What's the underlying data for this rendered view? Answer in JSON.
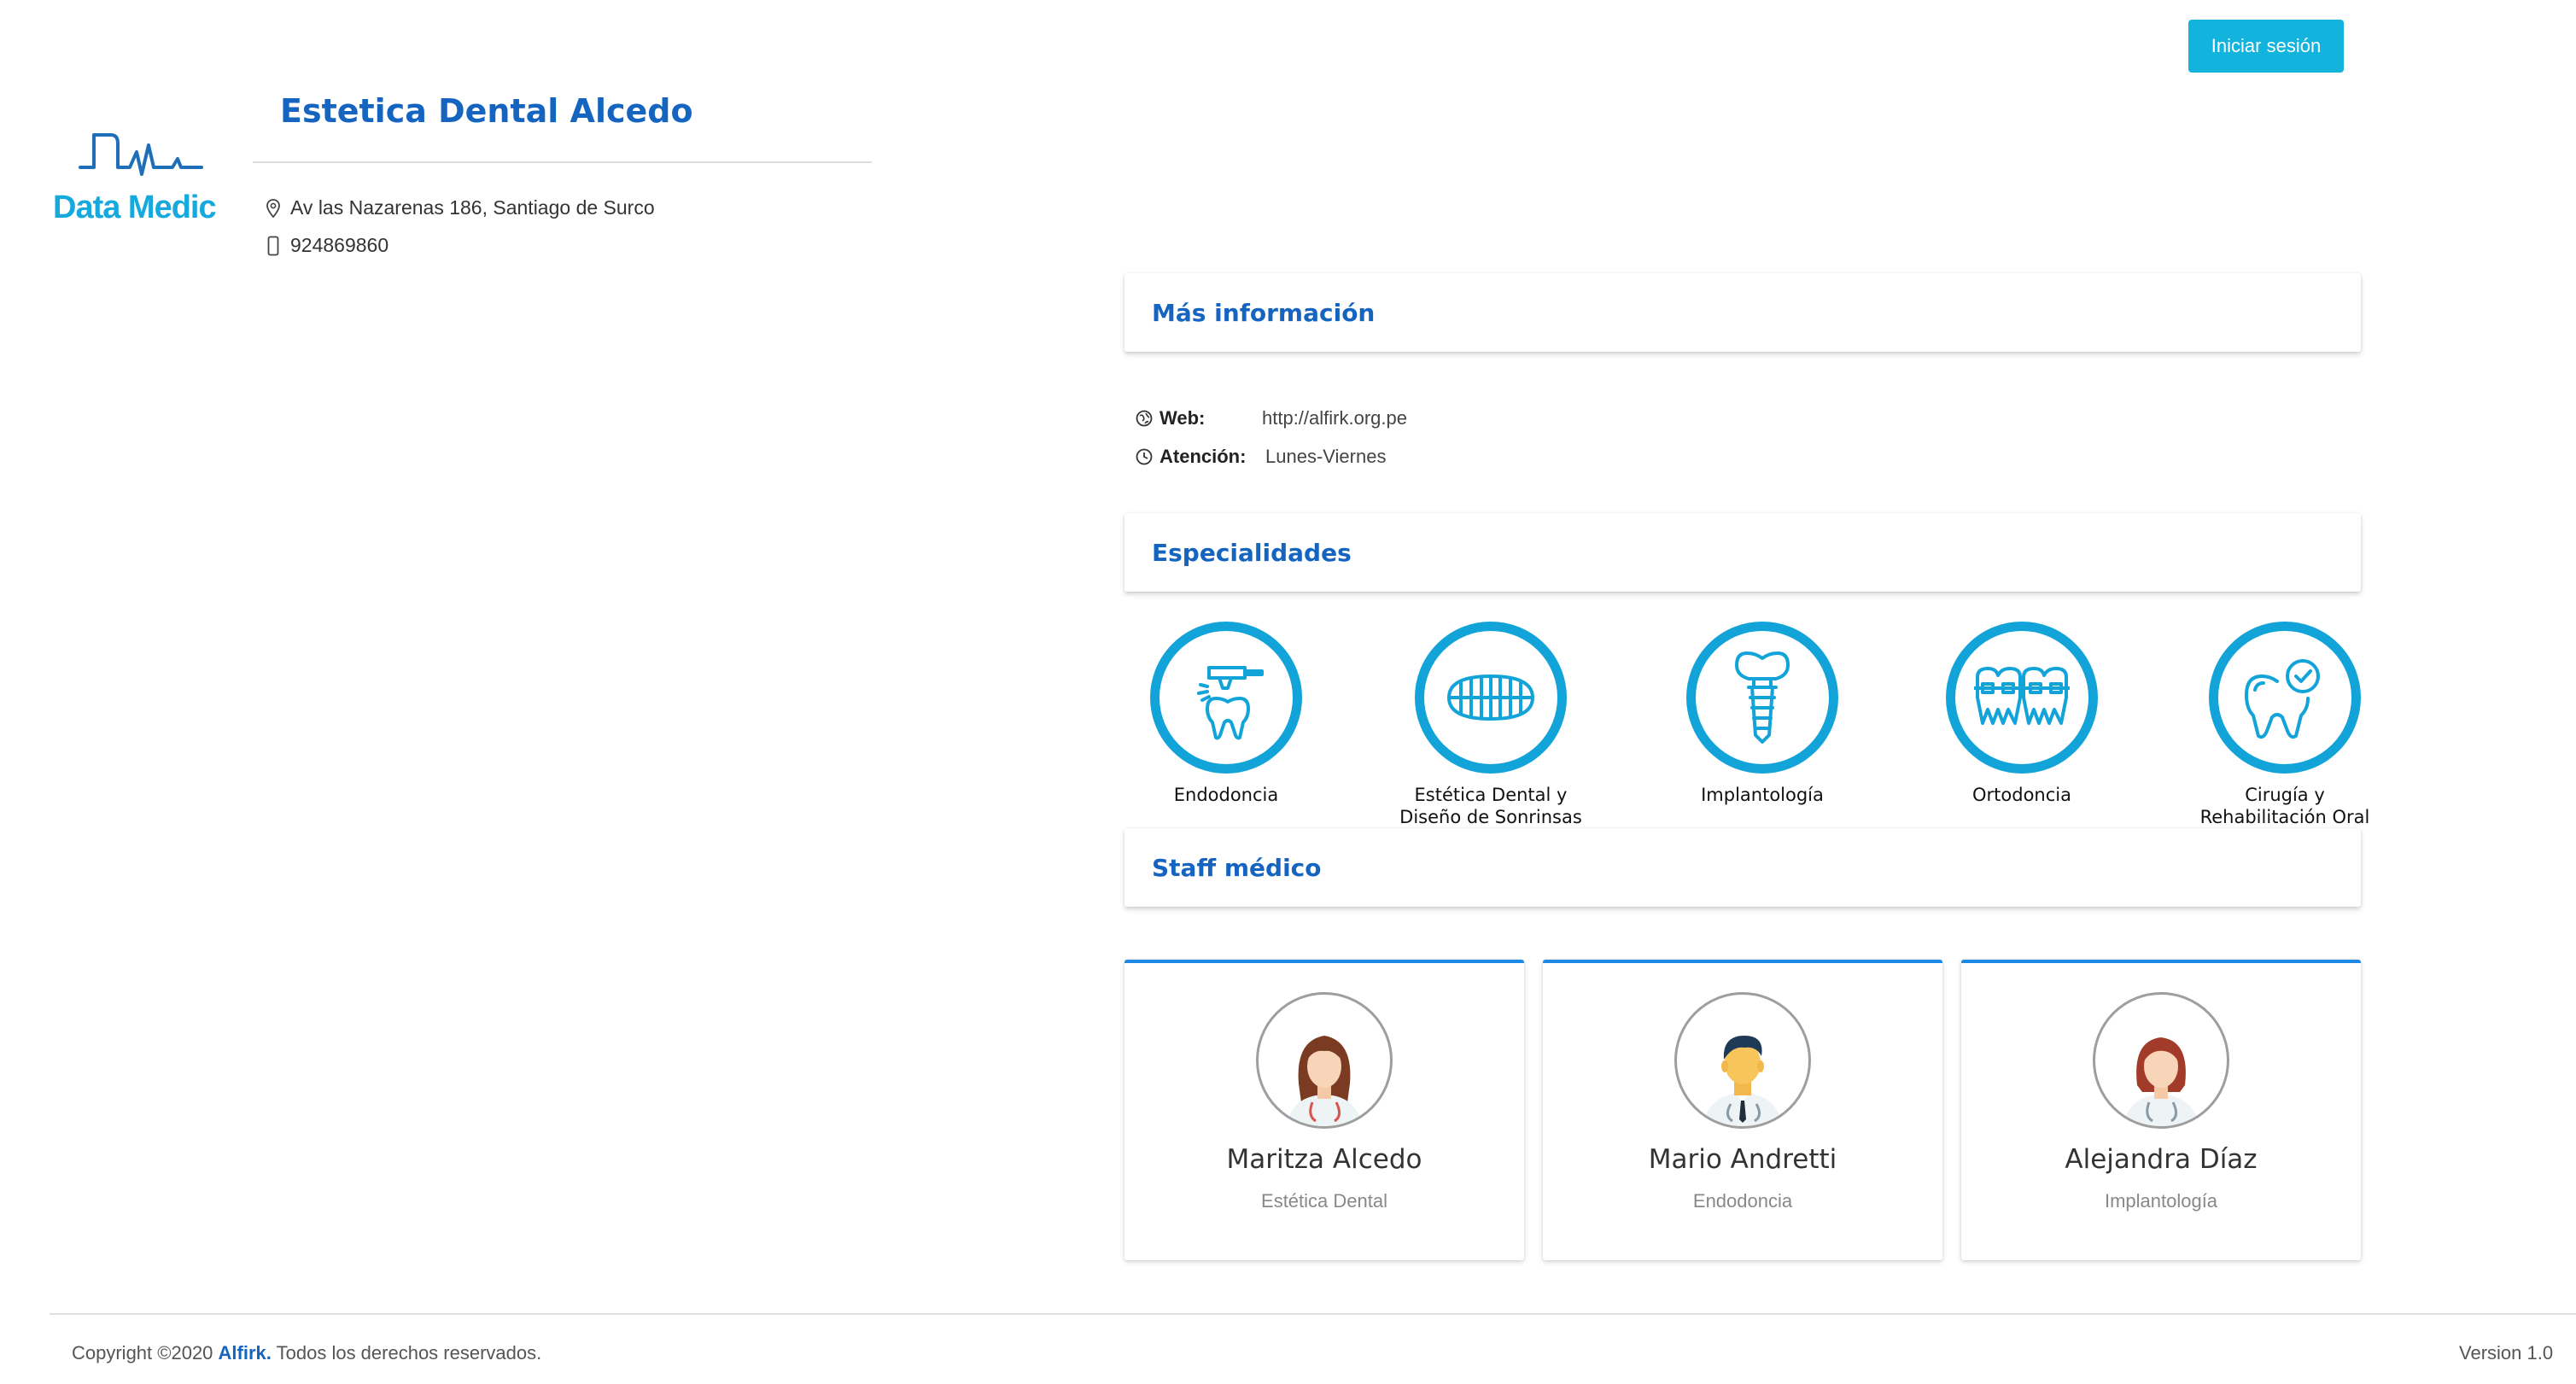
{
  "header": {
    "login_label": "Iniciar sesión",
    "logo_text": "Data Medic",
    "clinic_name": "Estetica Dental Alcedo",
    "address": "Av las Nazarenas 186, Santiago de Surco",
    "phone": "924869860"
  },
  "sections": {
    "info_title": "Más información",
    "specialties_title": "Especialidades",
    "staff_title": "Staff médico"
  },
  "info": {
    "web_label": "Web:",
    "web_value": "http://alfirk.org.pe",
    "attention_label": "Atención:",
    "attention_value": "Lunes-Viernes"
  },
  "specialties": [
    {
      "line1": "Endodoncia",
      "line2": "",
      "icon": "tooth-drill-icon"
    },
    {
      "line1": "Estética Dental y",
      "line2": "Diseño de Sonrinsas",
      "icon": "teeth-smile-icon"
    },
    {
      "line1": "Implantología",
      "line2": "",
      "icon": "dental-implant-icon"
    },
    {
      "line1": "Ortodoncia",
      "line2": "",
      "icon": "braces-icon"
    },
    {
      "line1": "Cirugía y",
      "line2": "Rehabilitación Oral",
      "icon": "tooth-check-icon"
    }
  ],
  "staff": [
    {
      "name": "Maritza Alcedo",
      "specialty": "Estética Dental",
      "avatar": "female-doctor-avatar"
    },
    {
      "name": "Mario Andretti",
      "specialty": "Endodoncia",
      "avatar": "male-doctor-avatar"
    },
    {
      "name": "Alejandra Díaz",
      "specialty": "Implantología",
      "avatar": "female-doctor-avatar"
    }
  ],
  "footer": {
    "copyright_prefix": "Copyright ©2020",
    "brand": "Alfirk.",
    "rights": "Todos los derechos reservados.",
    "version": "Version 1.0"
  },
  "colors": {
    "primary_blue": "#1565c0",
    "accent_cyan": "#12b3dd",
    "specialty_ring": "#12a4d9",
    "staff_card_top": "#1e88e5"
  }
}
